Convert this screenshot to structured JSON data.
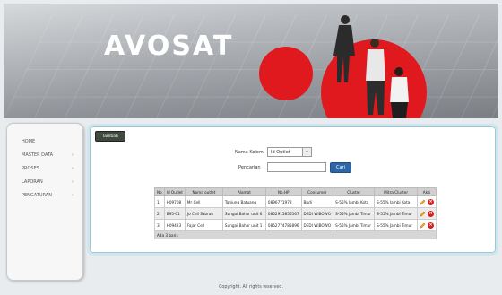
{
  "header": {
    "logo_text": "AVOSAT"
  },
  "sidebar": {
    "items": [
      {
        "label": "HOME",
        "has_arrow": false
      },
      {
        "label": "MASTER DATA",
        "has_arrow": true
      },
      {
        "label": "PROSES",
        "has_arrow": true
      },
      {
        "label": "LAPORAN",
        "has_arrow": true
      },
      {
        "label": "PENGATURAN",
        "has_arrow": true
      }
    ]
  },
  "toolbar": {
    "add_label": "Tambah"
  },
  "filter": {
    "field_label": "Nama Kolom",
    "field_value": "Id Outlet",
    "search_label": "Pencarian",
    "search_value": "",
    "search_button": "Cari"
  },
  "table": {
    "headers": [
      "No",
      "Id Outlet",
      "Nama outlet",
      "Alamat",
      "No.HP",
      "Consumer",
      "Cluster",
      "Mitra Cluster",
      "Aksi"
    ],
    "rows": [
      [
        "1",
        "H09708",
        "Mr Cell",
        "Tanjung Batuang",
        "0896771978",
        "Budi",
        "S-55% Jambi Kota",
        "S-55% Jambi Kota"
      ],
      [
        "2",
        "B95-01",
        "Jo Cell Sabrah",
        "Sungai Bahar unit 6",
        "0852915856567",
        "DEDI WIBOWO",
        "S-55% Jambi Timur",
        "S-55% Jambi Timur"
      ],
      [
        "3",
        "H09423",
        "Fajar Cell",
        "Sungai Bahar unit 1",
        "0852774785896",
        "DEDI WIBOWO",
        "S-55% Jambi Timur",
        "S-55% Jambi Timur"
      ]
    ],
    "footer_text": "Ada 3 baris"
  },
  "footer": {
    "copyright": "Copyright. All rights reserved."
  },
  "colors": {
    "brand_red": "#e0191e",
    "cari_button": "#2f66a8",
    "tambah_button": "#3d4a3c",
    "panel_border": "#cfe6ee"
  }
}
